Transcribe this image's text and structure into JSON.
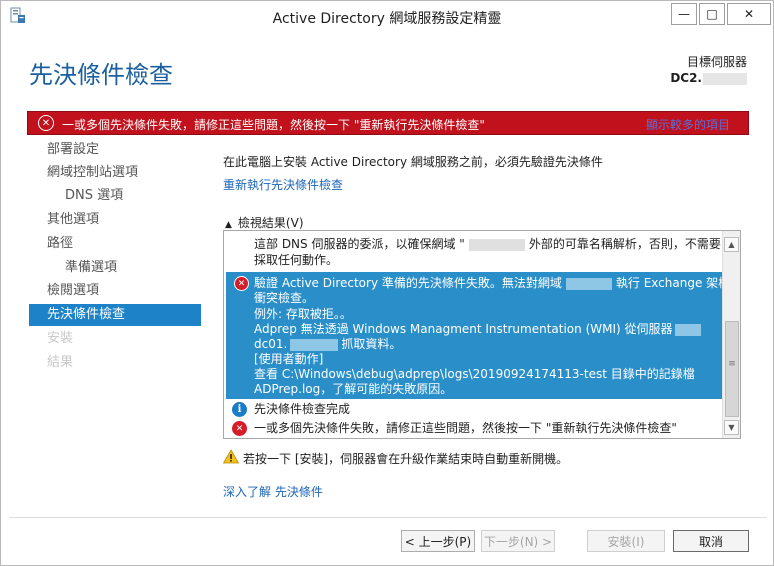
{
  "window": {
    "title": "Active Directory 網域服務設定精靈",
    "minimize_glyph": "—",
    "maximize_glyph": "□",
    "close_glyph": "✕"
  },
  "header": {
    "page_title": "先決條件檢查",
    "target_server_label": "目標伺服器",
    "target_server_name": "DC2."
  },
  "banner": {
    "icon": "error-circle-icon",
    "text": "一或多個先決條件失敗，請修正這些問題，然後按一下 \"重新執行先決條件檢查\"",
    "more": "顯示較多的項目",
    "close": "✕",
    "color": "#c0111c"
  },
  "sidebar": {
    "items": [
      {
        "label": "部署設定",
        "state": "normal",
        "indent": false
      },
      {
        "label": "網域控制站選項",
        "state": "normal",
        "indent": false
      },
      {
        "label": "DNS 選項",
        "state": "normal",
        "indent": true
      },
      {
        "label": "其他選項",
        "state": "normal",
        "indent": false
      },
      {
        "label": "路徑",
        "state": "normal",
        "indent": false
      },
      {
        "label": "準備選項",
        "state": "normal",
        "indent": true
      },
      {
        "label": "檢閱選項",
        "state": "normal",
        "indent": false
      },
      {
        "label": "先決條件檢查",
        "state": "active",
        "indent": false
      },
      {
        "label": "安裝",
        "state": "disabled",
        "indent": false
      },
      {
        "label": "結果",
        "state": "disabled",
        "indent": false
      }
    ],
    "active_color": "#1e82c8"
  },
  "main": {
    "intro": "在此電腦上安裝 Active Directory 網域服務之前，必須先驗證先決條件",
    "rerun_link": "重新執行先決條件檢查",
    "results_toggle": "檢視結果(V)",
    "results": {
      "line_a": "這部 DNS 伺服器的委派，以確保網域 \"",
      "line_a_tail": "外部的可靠名稱解析，否則，不需要",
      "line_b": "採取任何動作。",
      "selected": {
        "l1_pre": "驗證 Active Directory 準備的先決條件失敗。無法對網域",
        "l1_post": "執行 Exchange 架構",
        "l2": "衝突檢查。",
        "l3": "例外: 存取被拒。。",
        "l4": "Adprep 無法透過 Windows Managment Instrumentation (WMI) 從伺服器",
        "l5_pre": "dc01.",
        "l5_post": "抓取資料。",
        "l6": "[使用者動作]",
        "l7": "查看 C:\\Windows\\debug\\adprep\\logs\\20190924174113-test 目錄中的記錄檔",
        "l8": "ADPrep.log，了解可能的失敗原因。"
      },
      "info_line": "先決條件檢查完成",
      "error_line": "一或多個先決條件失敗，請修正這些問題，然後按一下 \"重新執行先決條件檢查\""
    },
    "warning": "若按一下 [安裝]，伺服器會在升級作業結束時自動重新開機。",
    "learn_more": "深入了解 先決條件"
  },
  "footer": {
    "prev": "< 上一步(P)",
    "next": "下一步(N) >",
    "install": "安裝(I)",
    "cancel": "取消"
  }
}
